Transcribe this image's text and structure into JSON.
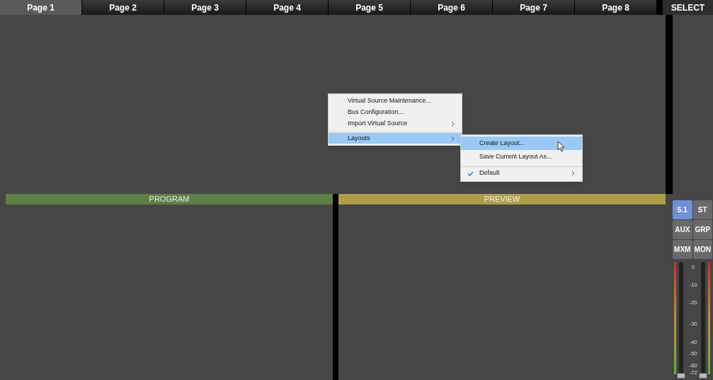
{
  "tabs": [
    {
      "label": "Page 1",
      "selected": true
    },
    {
      "label": "Page 2",
      "selected": false
    },
    {
      "label": "Page 3",
      "selected": false
    },
    {
      "label": "Page 4",
      "selected": false
    },
    {
      "label": "Page 5",
      "selected": false
    },
    {
      "label": "Page 6",
      "selected": false
    },
    {
      "label": "Page 7",
      "selected": false
    },
    {
      "label": "Page 8",
      "selected": false
    }
  ],
  "select_header": "SELECT",
  "context_menu": {
    "items": [
      {
        "label": "Virtual Source Maintenance...",
        "submenu": false,
        "selected": false
      },
      {
        "label": "Bus Configuration...",
        "submenu": false,
        "selected": false
      },
      {
        "label": "Import Virtual Source",
        "submenu": true,
        "selected": false
      },
      {
        "label": "Layouts",
        "submenu": true,
        "selected": true,
        "separator_before": true
      }
    ],
    "submenu": {
      "items": [
        {
          "label": "Create Layout...",
          "selected": true,
          "checked": false,
          "submenu": false
        },
        {
          "label": "Save Current Layout As...",
          "selected": false,
          "checked": false,
          "submenu": false
        },
        {
          "label": "Default",
          "selected": false,
          "checked": true,
          "submenu": true,
          "separator_before": true
        }
      ]
    }
  },
  "program": {
    "title": "PROGRAM"
  },
  "preview": {
    "title": "PREVIEW"
  },
  "bus_buttons": [
    {
      "label": "5.1",
      "selected": true
    },
    {
      "label": "ST",
      "selected": false
    },
    {
      "label": "AUX",
      "selected": false
    },
    {
      "label": "GRP",
      "selected": false
    },
    {
      "label": "MXM",
      "selected": false
    },
    {
      "label": "MON",
      "selected": false
    }
  ],
  "meter": {
    "scale": [
      "0",
      "-10",
      "-20",
      "-30",
      "-40",
      "-50",
      "-60",
      "-72"
    ],
    "faders": [
      {
        "level": 0
      },
      {
        "level": 0
      }
    ]
  }
}
